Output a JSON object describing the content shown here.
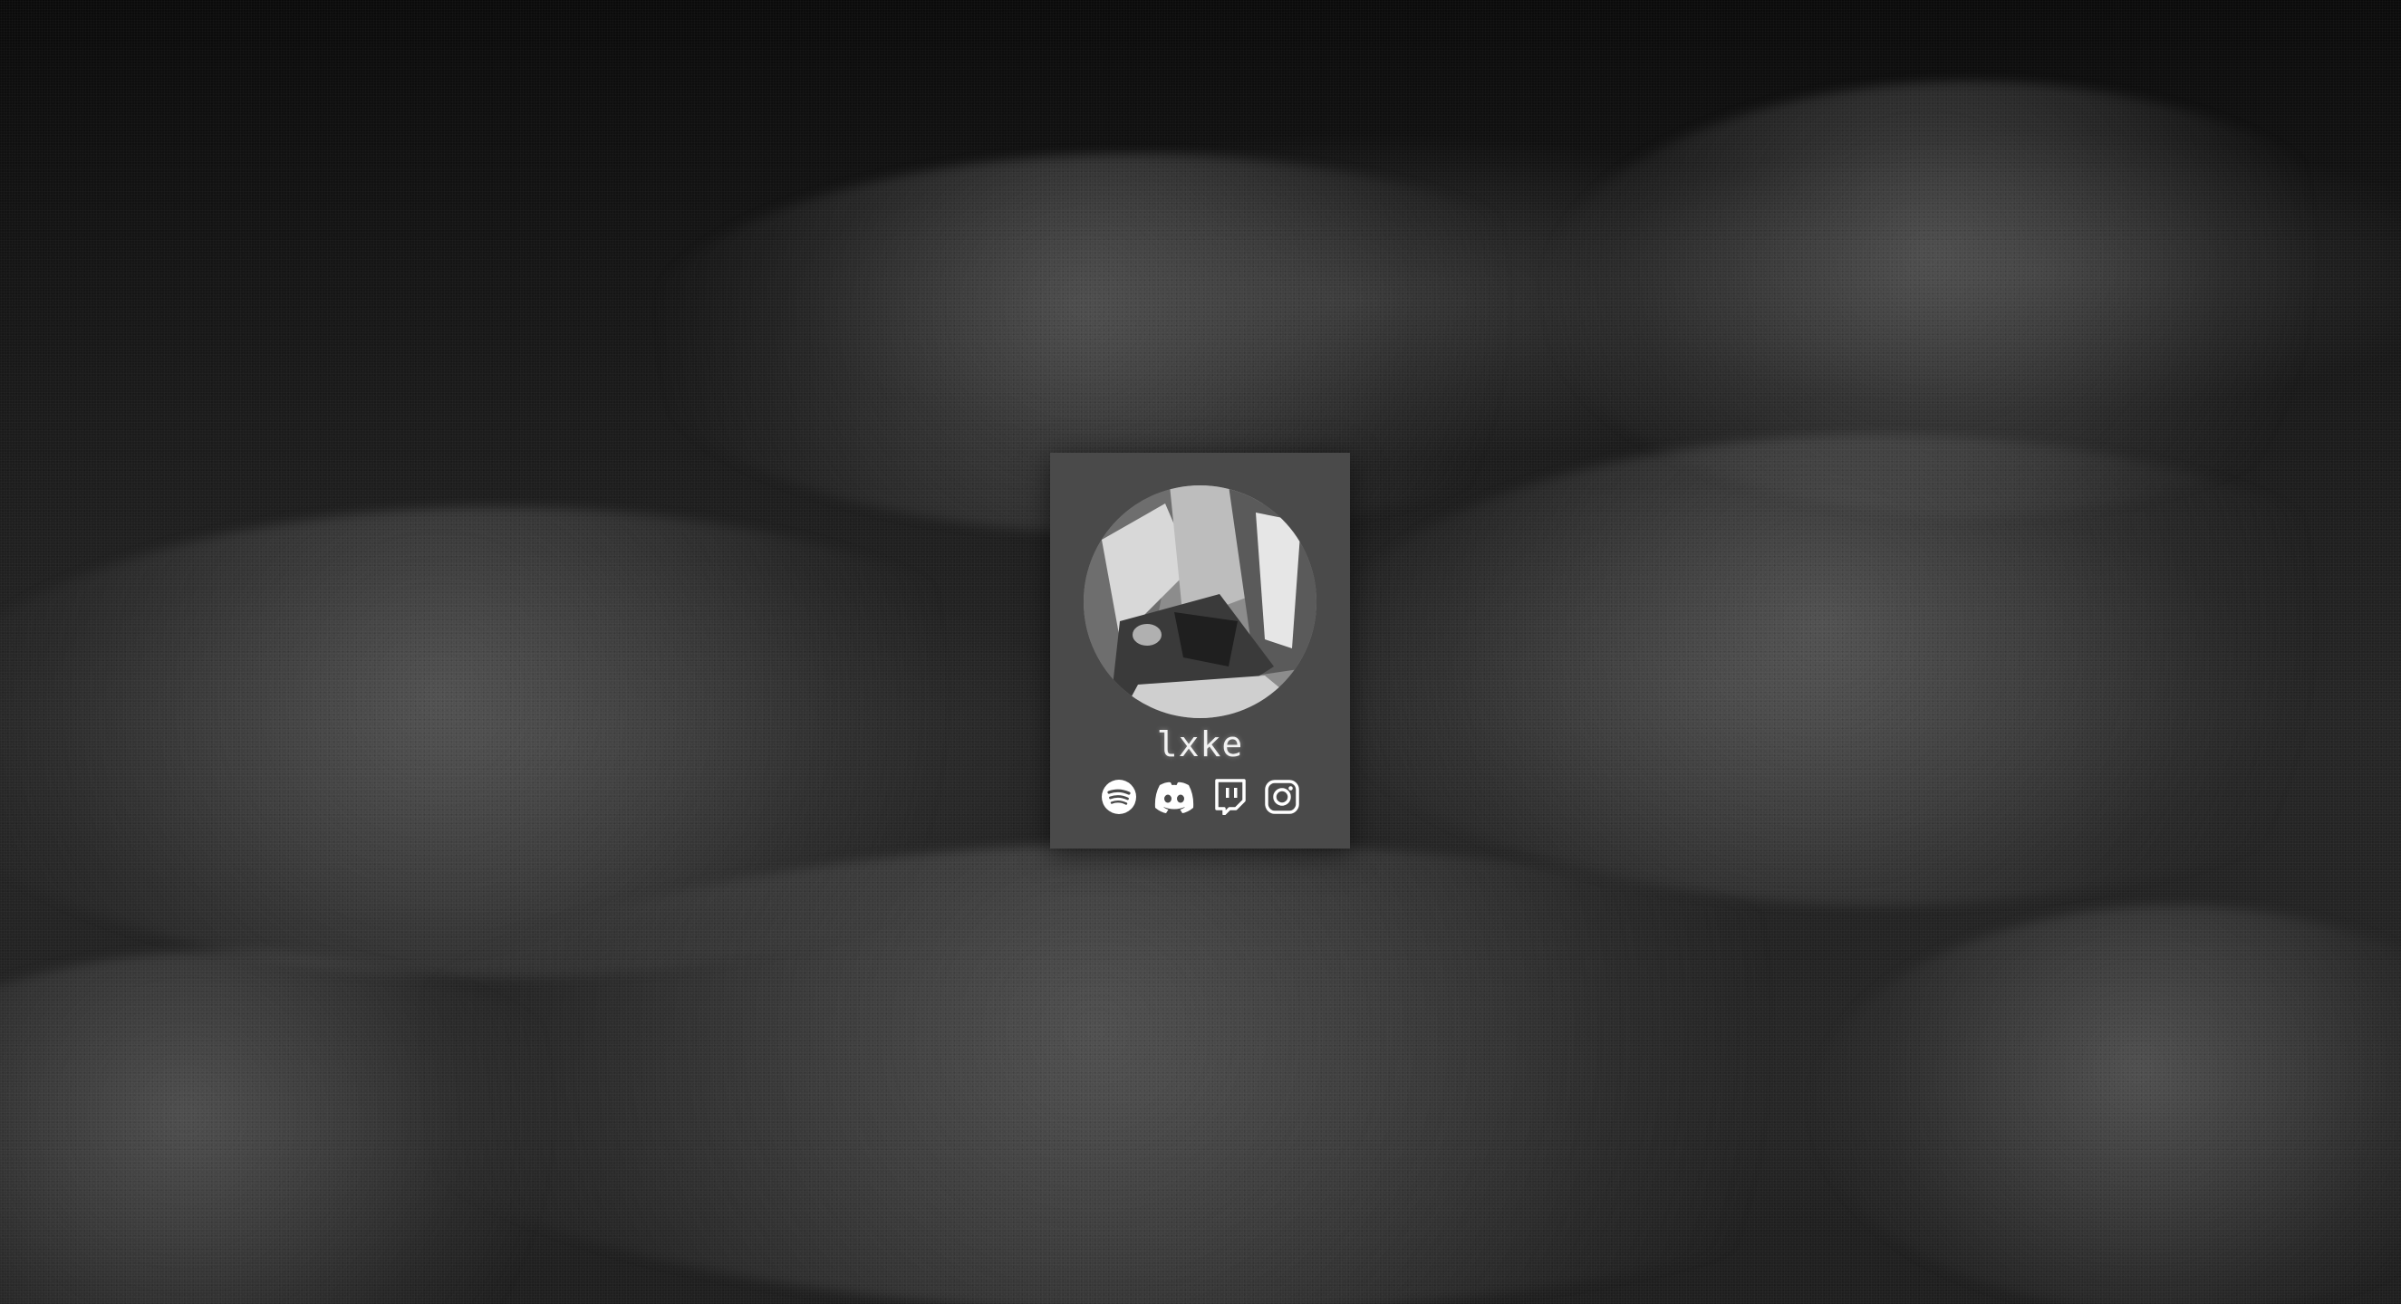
{
  "profile": {
    "username": "lxke"
  },
  "social_links": [
    {
      "icon": "spotify-icon"
    },
    {
      "icon": "discord-icon"
    },
    {
      "icon": "twitch-icon"
    },
    {
      "icon": "instagram-icon"
    }
  ],
  "colors": {
    "background": "#1a1a1a",
    "card": "#4a4a4a",
    "text": "#f2f2f2",
    "icon": "#ffffff"
  }
}
